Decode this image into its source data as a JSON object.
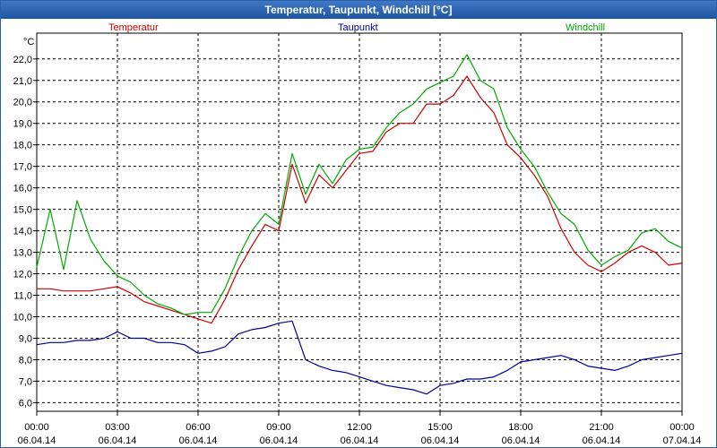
{
  "window": {
    "title": "Temperatur, Taupunkt, Windchill [°C]"
  },
  "chart_data": {
    "type": "line",
    "title": "Temperatur, Taupunkt, Windchill [°C]",
    "y_unit": "°C",
    "ylim": [
      5.6,
      23.2
    ],
    "y_ticks": [
      "6,0",
      "7,0",
      "8,0",
      "9,0",
      "10,0",
      "11,0",
      "12,0",
      "13,0",
      "14,0",
      "15,0",
      "16,0",
      "17,0",
      "18,0",
      "19,0",
      "20,0",
      "21,0",
      "22,0"
    ],
    "x_ticks": [
      {
        "time": "00:00",
        "date": "06.04.14"
      },
      {
        "time": "03:00",
        "date": "06.04.14"
      },
      {
        "time": "06:00",
        "date": "06.04.14"
      },
      {
        "time": "09:00",
        "date": "06.04.14"
      },
      {
        "time": "12:00",
        "date": "06.04.14"
      },
      {
        "time": "15:00",
        "date": "06.04.14"
      },
      {
        "time": "18:00",
        "date": "06.04.14"
      },
      {
        "time": "21:00",
        "date": "06.04.14"
      },
      {
        "time": "00:00",
        "date": "07.04.14"
      }
    ],
    "x_hours": [
      0,
      0.5,
      1,
      1.5,
      2,
      2.5,
      3,
      3.5,
      4,
      4.5,
      5,
      5.5,
      6,
      6.5,
      7,
      7.5,
      8,
      8.5,
      9,
      9.5,
      10,
      10.5,
      11,
      11.5,
      12,
      12.5,
      13,
      13.5,
      14,
      14.5,
      15,
      15.5,
      16,
      16.5,
      17,
      17.5,
      18,
      18.5,
      19,
      19.5,
      20,
      20.5,
      21,
      21.5,
      22,
      22.5,
      23,
      23.5,
      24
    ],
    "grid": true,
    "series": [
      {
        "name": "Temperatur",
        "color": "#cc0000",
        "values": [
          11.3,
          11.3,
          11.2,
          11.2,
          11.2,
          11.3,
          11.4,
          11.1,
          10.7,
          10.5,
          10.3,
          10.1,
          9.9,
          9.7,
          10.8,
          12.2,
          13.3,
          14.3,
          14.0,
          17.1,
          15.3,
          16.6,
          16.0,
          16.8,
          17.6,
          17.7,
          18.6,
          19.0,
          19.0,
          19.9,
          19.9,
          20.3,
          21.2,
          20.2,
          19.5,
          18.0,
          17.4,
          16.6,
          15.6,
          14.1,
          13.0,
          12.4,
          12.1,
          12.5,
          13.0,
          13.3,
          13.0,
          12.4,
          12.5
        ]
      },
      {
        "name": "Taupunkt",
        "color": "#000099",
        "values": [
          8.7,
          8.8,
          8.8,
          8.9,
          8.9,
          9.0,
          9.3,
          9.0,
          9.0,
          8.8,
          8.8,
          8.7,
          8.3,
          8.4,
          8.6,
          9.2,
          9.4,
          9.5,
          9.7,
          9.8,
          8.0,
          7.7,
          7.5,
          7.4,
          7.2,
          7.0,
          6.8,
          6.7,
          6.6,
          6.4,
          6.8,
          6.9,
          7.1,
          7.1,
          7.2,
          7.5,
          7.9,
          8.0,
          8.1,
          8.2,
          8.0,
          7.7,
          7.6,
          7.5,
          7.7,
          8.0,
          8.1,
          8.2,
          8.3
        ]
      },
      {
        "name": "Windchill",
        "color": "#00aa00",
        "values": [
          12.3,
          15.0,
          12.2,
          15.4,
          13.6,
          12.6,
          11.9,
          11.6,
          11.0,
          10.6,
          10.4,
          10.1,
          10.2,
          10.2,
          11.3,
          12.8,
          14.0,
          14.8,
          14.3,
          17.6,
          15.7,
          17.1,
          16.2,
          17.3,
          17.8,
          17.9,
          18.8,
          19.5,
          19.9,
          20.6,
          20.9,
          21.2,
          22.2,
          21.0,
          20.6,
          18.8,
          17.8,
          17.0,
          15.8,
          14.8,
          14.3,
          13.1,
          12.4,
          12.8,
          13.1,
          13.9,
          14.1,
          13.5,
          13.2
        ]
      }
    ]
  }
}
